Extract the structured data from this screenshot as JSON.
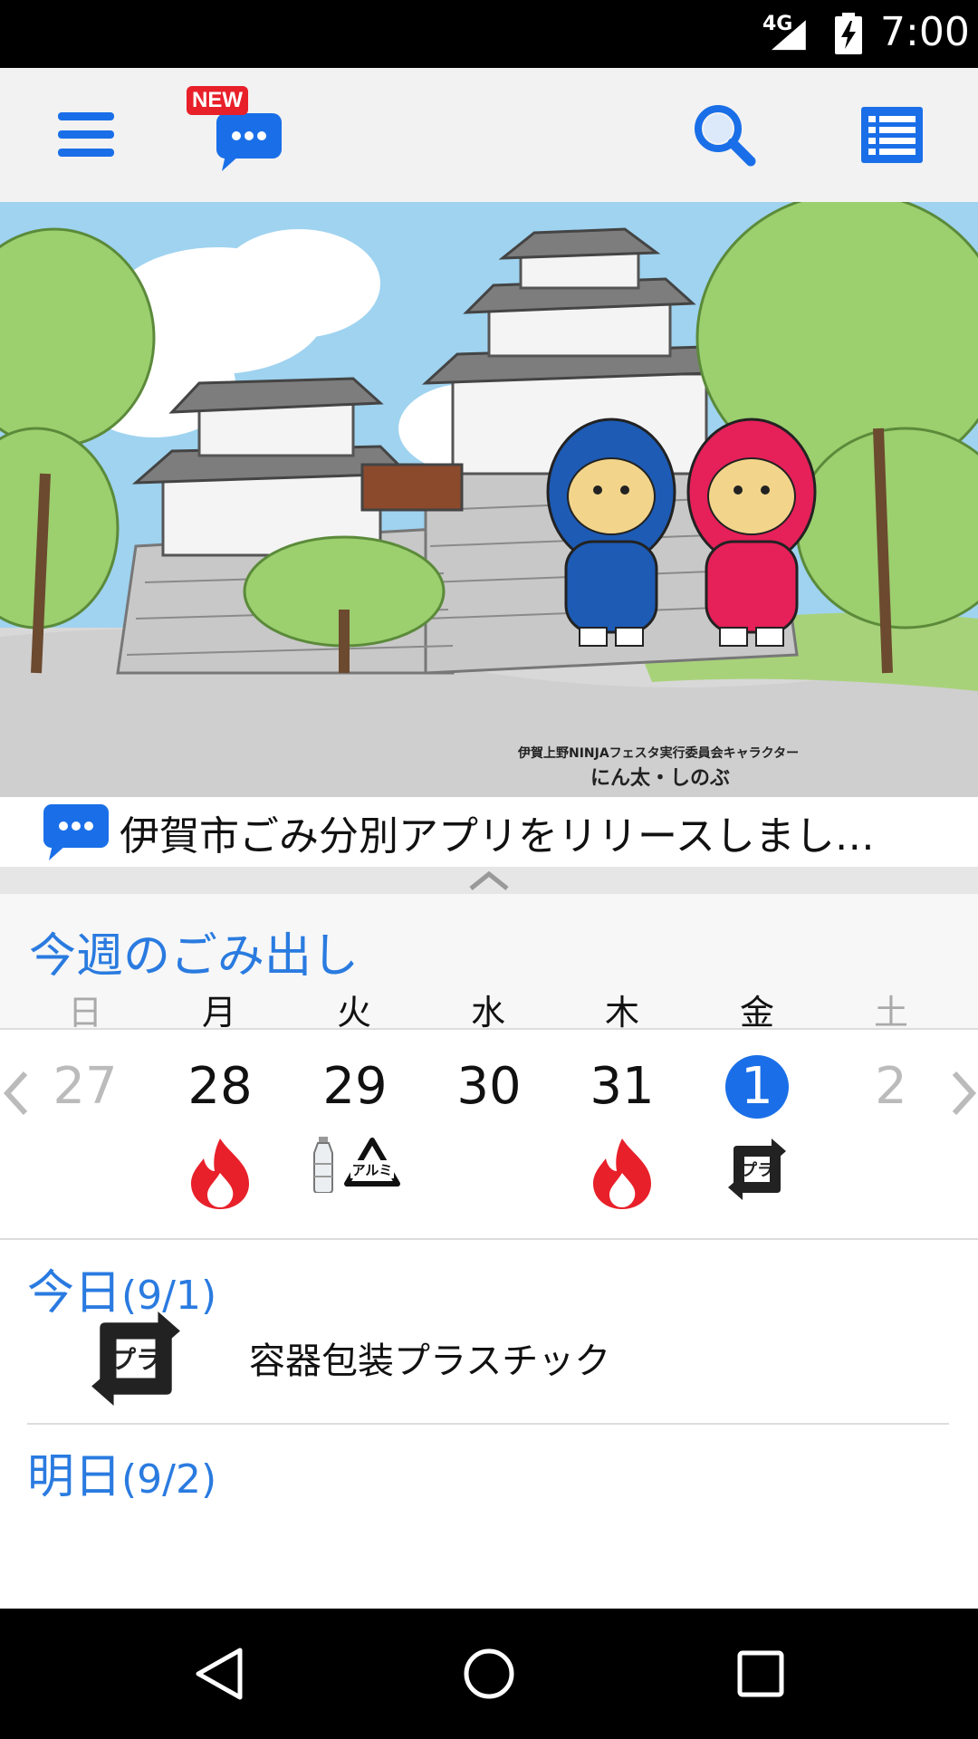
{
  "status_bar": {
    "network": "4G",
    "time": "7:00"
  },
  "toolbar": {
    "new_badge": "NEW"
  },
  "banner": {
    "caption_line1": "伊賀上野NINJAフェスタ実行委員会キャラクター",
    "caption_line2": "にん太・しのぶ"
  },
  "news": {
    "text": "伊賀市ごみ分別アプリをリリースしまし…"
  },
  "week": {
    "title": "今週のごみ出し",
    "weekdays": [
      "日",
      "月",
      "火",
      "水",
      "木",
      "金",
      "土"
    ],
    "days": [
      {
        "num": "27",
        "state": "muted",
        "icons": []
      },
      {
        "num": "28",
        "state": "normal",
        "icons": [
          "burnable-fire-icon"
        ]
      },
      {
        "num": "29",
        "state": "normal",
        "icons": [
          "pet-bottle-icon",
          "aluminum-can-icon"
        ]
      },
      {
        "num": "30",
        "state": "normal",
        "icons": []
      },
      {
        "num": "31",
        "state": "normal",
        "icons": [
          "burnable-fire-icon"
        ]
      },
      {
        "num": "1",
        "state": "today",
        "icons": [
          "plastic-recycle-icon"
        ]
      },
      {
        "num": "2",
        "state": "muted",
        "icons": []
      }
    ]
  },
  "today": {
    "label": "今日",
    "date": "(9/1)",
    "item_name": "容器包装プラスチック",
    "item_icon": "plastic-recycle-icon",
    "plastic_mark": "プラ"
  },
  "tomorrow": {
    "label": "明日",
    "date": "(9/2)"
  },
  "icon_labels": {
    "aluminum": "アルミ"
  },
  "colors": {
    "accent": "#2a7be0",
    "today_circle": "#1a6fe8",
    "fire": "#e8202a"
  }
}
